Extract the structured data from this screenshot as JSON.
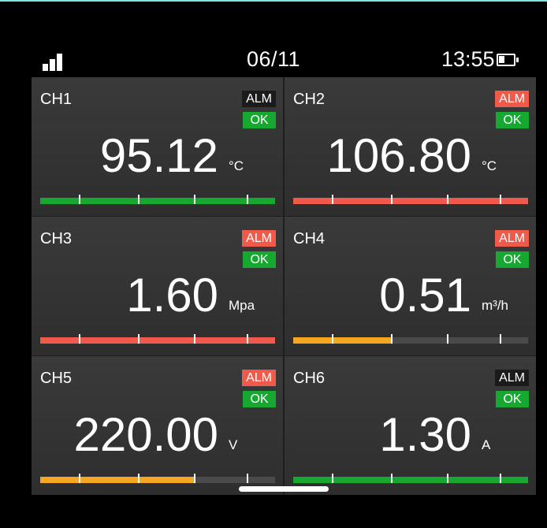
{
  "status": {
    "date": "06/11",
    "time": "13:55",
    "signal_icon": "signal-bars-icon",
    "battery_icon": "battery-icon"
  },
  "colors": {
    "green": "#17a832",
    "red": "#f05a4a",
    "orange": "#f5a623",
    "alm_inactive": "#1b1b1b",
    "track": "#4a4a4a"
  },
  "channels": [
    {
      "name": "CH1",
      "alarm": "ALM",
      "alarm_active": false,
      "state": "OK",
      "value": "95.12",
      "unit": "°C",
      "bar_color": "#17a832",
      "level": 1.0
    },
    {
      "name": "CH2",
      "alarm": "ALM",
      "alarm_active": true,
      "state": "OK",
      "value": "106.80",
      "unit": "°C",
      "bar_color": "#f05a4a",
      "level": 1.0
    },
    {
      "name": "CH3",
      "alarm": "ALM",
      "alarm_active": true,
      "state": "OK",
      "value": "1.60",
      "unit": "Mpa",
      "bar_color": "#f05a4a",
      "level": 1.0
    },
    {
      "name": "CH4",
      "alarm": "ALM",
      "alarm_active": true,
      "state": "OK",
      "value": "0.51",
      "unit": "m³/h",
      "bar_color": "#f5a623",
      "level": 0.42
    },
    {
      "name": "CH5",
      "alarm": "ALM",
      "alarm_active": true,
      "state": "OK",
      "value": "220.00",
      "unit": "V",
      "bar_color": "#f5a623",
      "level": 0.66
    },
    {
      "name": "CH6",
      "alarm": "ALM",
      "alarm_active": false,
      "state": "OK",
      "value": "1.30",
      "unit": "A",
      "bar_color": "#17a832",
      "level": 1.0
    }
  ]
}
